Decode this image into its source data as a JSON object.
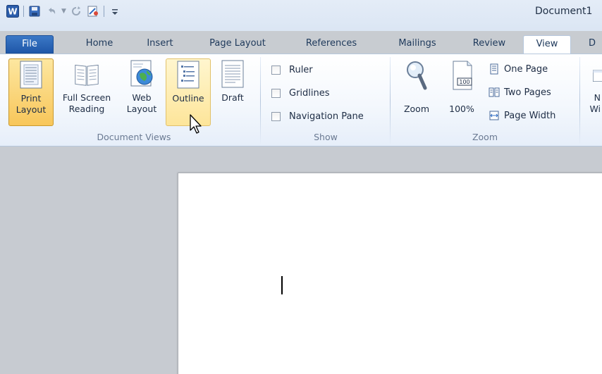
{
  "window": {
    "title": "Document1"
  },
  "qat": {
    "word_icon": "word-logo-icon",
    "save_icon": "save-icon",
    "undo_icon": "undo-icon",
    "redo_icon": "redo-icon",
    "customize_icon": "customize-qat-icon"
  },
  "tabs": [
    {
      "label": "File"
    },
    {
      "label": "Home"
    },
    {
      "label": "Insert"
    },
    {
      "label": "Page Layout"
    },
    {
      "label": "References"
    },
    {
      "label": "Mailings"
    },
    {
      "label": "Review"
    },
    {
      "label": "View"
    },
    {
      "label": "D"
    }
  ],
  "ribbon": {
    "document_views": {
      "label": "Document Views",
      "print_layout": {
        "line1": "Print",
        "line2": "Layout"
      },
      "full_screen": {
        "line1": "Full Screen",
        "line2": "Reading"
      },
      "web_layout": {
        "line1": "Web",
        "line2": "Layout"
      },
      "outline": {
        "line1": "Outline"
      },
      "draft": {
        "line1": "Draft"
      }
    },
    "show": {
      "label": "Show",
      "ruler": "Ruler",
      "gridlines": "Gridlines",
      "navigation_pane": "Navigation Pane"
    },
    "zoom": {
      "label": "Zoom",
      "zoom_btn": "Zoom",
      "hundred_btn": "100%",
      "hundred_icon_text": "100",
      "one_page": "One Page",
      "two_pages": "Two Pages",
      "page_width": "Page Width"
    },
    "window_partial": {
      "line1": "N",
      "line2": "Wi"
    }
  },
  "colors": {
    "accent": "#1f57a8",
    "selected": "#f8c65a",
    "ribbon_bg": "#f4f8fd",
    "doc_bg": "#c7cbd1"
  }
}
